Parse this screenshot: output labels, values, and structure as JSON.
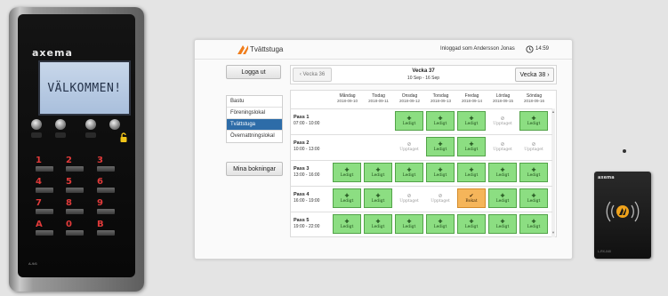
{
  "device": {
    "brand": "axema",
    "screen_text": "VÄLKOMMEN!",
    "keys": [
      "1",
      "2",
      "3",
      "4",
      "5",
      "6",
      "7",
      "8",
      "9",
      "A",
      "0",
      "B"
    ],
    "model": "A-9/6"
  },
  "app": {
    "title": "Tvättstuga",
    "logged_in_text": "Inloggad som Andersson Jonas",
    "time": "14:59"
  },
  "sidebar": {
    "logout_label": "Logga ut",
    "rooms": [
      "Bastu",
      "Föreningslokal",
      "Tvättstuga",
      "Övernattningslokal"
    ],
    "active_room": "Tvättstuga",
    "my_bookings_label": "Mina bokningar"
  },
  "week_nav": {
    "prev_label": "Vecka 36",
    "title": "Vecka 37",
    "range": "10 Sep - 16 Sep",
    "next_label": "Vecka 38"
  },
  "status_labels": {
    "free": "Ledigt",
    "busy": "Upptaget",
    "booked": "Bokat"
  },
  "days": [
    {
      "name": "Måndag",
      "date": "2018-09-10"
    },
    {
      "name": "Tisdag",
      "date": "2018-09-11"
    },
    {
      "name": "Onsdag",
      "date": "2018-09-12"
    },
    {
      "name": "Torsdag",
      "date": "2018-09-13"
    },
    {
      "name": "Fredag",
      "date": "2018-09-14"
    },
    {
      "name": "Lördag",
      "date": "2018-09-15"
    },
    {
      "name": "Söndag",
      "date": "2018-09-16"
    }
  ],
  "passes": [
    {
      "name": "Pass 1",
      "time": "07:00 - 10:00",
      "slots": [
        "none",
        "none",
        "free",
        "free",
        "free",
        "busy",
        "free"
      ]
    },
    {
      "name": "Pass 2",
      "time": "10:00 - 13:00",
      "slots": [
        "none",
        "none",
        "busy",
        "free",
        "free",
        "busy",
        "busy"
      ]
    },
    {
      "name": "Pass 3",
      "time": "13:00 - 16:00",
      "slots": [
        "free",
        "free",
        "free",
        "free",
        "free",
        "free",
        "free"
      ]
    },
    {
      "name": "Pass 4",
      "time": "16:00 - 19:00",
      "slots": [
        "free",
        "free",
        "busy",
        "busy",
        "booked",
        "free",
        "free"
      ]
    },
    {
      "name": "Pass 5",
      "time": "19:00 - 22:00",
      "slots": [
        "free",
        "free",
        "free",
        "free",
        "free",
        "free",
        "free"
      ]
    }
  ],
  "reader": {
    "brand": "axema",
    "model": "L-RX-040"
  },
  "colors": {
    "free": "#8cde82",
    "booked": "#f5b55a",
    "active_room": "#2d6ca8",
    "key_digit": "#e03a3a"
  }
}
